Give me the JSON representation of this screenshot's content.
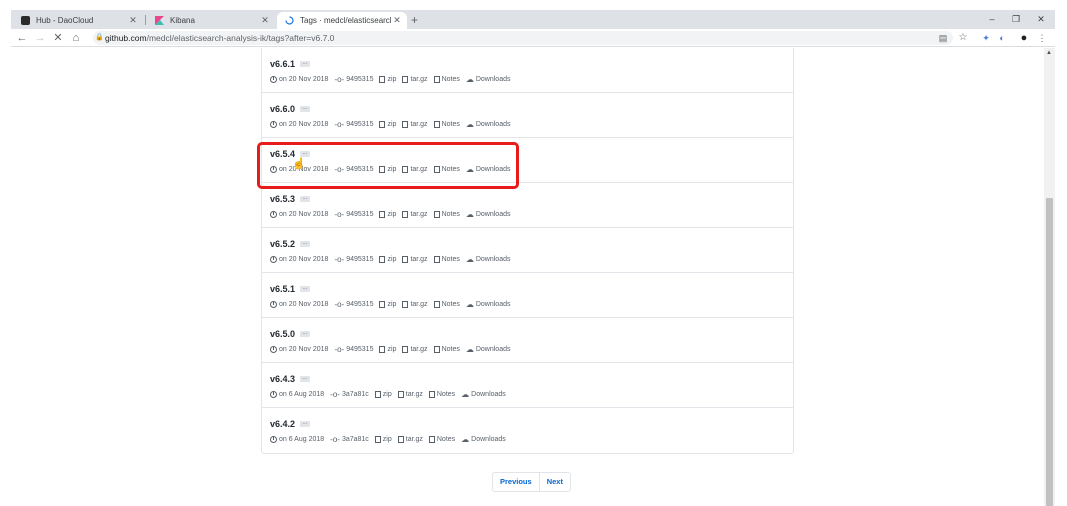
{
  "browser": {
    "tabs": [
      {
        "title": "Hub - DaoCloud",
        "icon": "daocloud-icon",
        "active": false
      },
      {
        "title": "Kibana",
        "icon": "kibana-icon",
        "active": false
      },
      {
        "title": "Tags · medcl/elasticsearch-an",
        "icon": "loading-spinner-icon",
        "active": true
      }
    ],
    "new_tab_label": "+",
    "window_controls": [
      "–",
      "❐",
      "✕"
    ],
    "url_host": "github.com",
    "url_path": "/medcl/elasticsearch-analysis-ik/tags?after=v6.7.0"
  },
  "tags": [
    {
      "name": "v6.6.1",
      "date": "on 20 Nov 2018",
      "commit": "9495315"
    },
    {
      "name": "v6.6.0",
      "date": "on 20 Nov 2018",
      "commit": "9495315"
    },
    {
      "name": "v6.5.4",
      "date": "on 20 Nov 2018",
      "commit": "9495315"
    },
    {
      "name": "v6.5.3",
      "date": "on 20 Nov 2018",
      "commit": "9495315"
    },
    {
      "name": "v6.5.2",
      "date": "on 20 Nov 2018",
      "commit": "9495315"
    },
    {
      "name": "v6.5.1",
      "date": "on 20 Nov 2018",
      "commit": "9495315"
    },
    {
      "name": "v6.5.0",
      "date": "on 20 Nov 2018",
      "commit": "9495315"
    },
    {
      "name": "v6.4.3",
      "date": "on 6 Aug 2018",
      "commit": "3a7a81c"
    },
    {
      "name": "v6.4.2",
      "date": "on 6 Aug 2018",
      "commit": "3a7a81c"
    }
  ],
  "tag_links": {
    "zip": "zip",
    "targz": "tar.gz",
    "notes": "Notes",
    "downloads": "Downloads"
  },
  "ellipsis_label": "...",
  "pagination": {
    "previous": "Previous",
    "next": "Next"
  },
  "highlight_color": "#e81b1b",
  "link_color": "#0366d6"
}
